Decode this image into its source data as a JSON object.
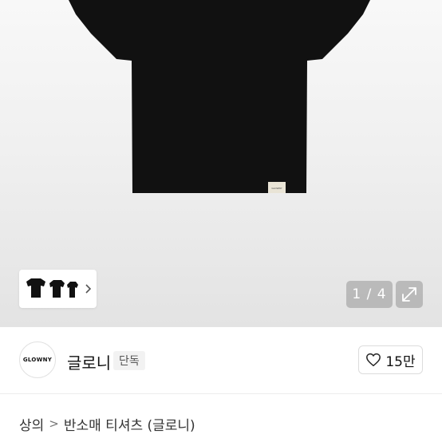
{
  "gallery": {
    "page_counter": "1 / 4",
    "label_tag_text": "GLOWNY"
  },
  "brand": {
    "logo_text": "GLOWNY",
    "name": "글로니",
    "badge": "단독"
  },
  "like": {
    "count": "15만"
  },
  "breadcrumb": {
    "category": "상의",
    "separator": ">",
    "subcategory": "반소매 티셔츠 (글로니)"
  },
  "colors": {
    "shirt": "#111111",
    "accent_text": "#111111",
    "overlay": "#969696"
  },
  "icons": {
    "expand": "expand-arrow-icon",
    "heart": "heart-outline-icon",
    "thumb_next": "chevron-right-icon"
  }
}
